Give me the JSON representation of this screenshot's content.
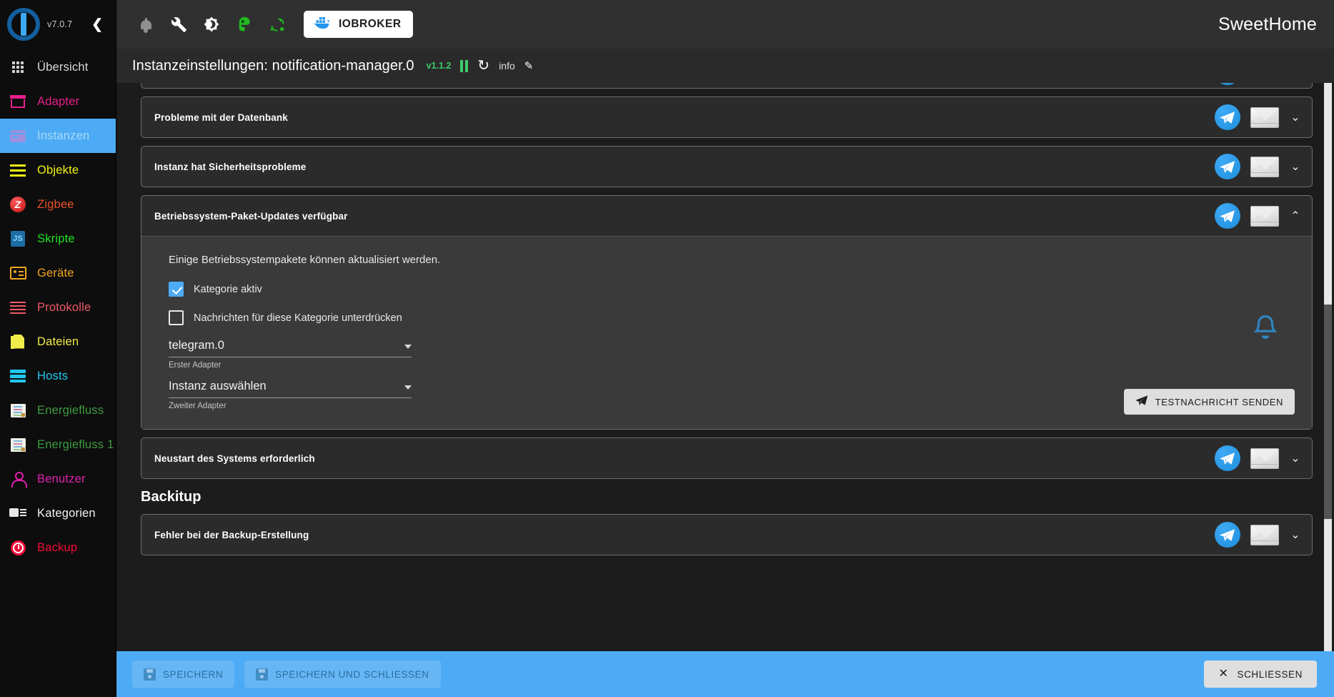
{
  "sidebar": {
    "version": "v7.0.7",
    "collapse_icon": "chevron-left-icon",
    "items": [
      {
        "label": "Übersicht",
        "icon": "grid-icon",
        "color": "#dcdcdc",
        "active": false
      },
      {
        "label": "Adapter",
        "icon": "shop-icon",
        "color": "#e91e8c",
        "active": false
      },
      {
        "label": "Instanzen",
        "icon": "instances-icon",
        "color": "#a9d9f7",
        "active": true
      },
      {
        "label": "Objekte",
        "icon": "list-icon",
        "color": "#f3f315",
        "active": false
      },
      {
        "label": "Zigbee",
        "icon": "zigbee-icon",
        "color": "#e8512a",
        "active": false
      },
      {
        "label": "Skripte",
        "icon": "javascript-icon",
        "color": "#21e421",
        "active": false
      },
      {
        "label": "Geräte",
        "icon": "devices-icon",
        "color": "#f0a520",
        "active": false
      },
      {
        "label": "Protokolle",
        "icon": "log-icon",
        "color": "#ef5a68",
        "active": false
      },
      {
        "label": "Dateien",
        "icon": "files-icon",
        "color": "#f0ec4a",
        "active": false
      },
      {
        "label": "Hosts",
        "icon": "hosts-icon",
        "color": "#22c7ee",
        "active": false
      },
      {
        "label": "Energiefluss",
        "icon": "flow-icon",
        "color": "#3f9b3f",
        "active": false
      },
      {
        "label": "Energiefluss 1",
        "icon": "flow-icon",
        "color": "#3f9b3f",
        "active": false
      },
      {
        "label": "Benutzer",
        "icon": "user-icon",
        "color": "#e020b0",
        "active": false
      },
      {
        "label": "Kategorien",
        "icon": "categories-icon",
        "color": "#f2f2f2",
        "active": false
      },
      {
        "label": "Backup",
        "icon": "backup-icon",
        "color": "#f20d3a",
        "active": false
      }
    ]
  },
  "topbar": {
    "icons": [
      "bell-icon",
      "wrench-icon",
      "brightness-icon",
      "bot-head-icon",
      "sync-icon"
    ],
    "host_button": {
      "label": "IOBROKER",
      "icon": "docker-icon"
    },
    "app_title": "SweetHome"
  },
  "subheader": {
    "title": "Instanzeinstellungen: notification-manager.0",
    "version": "v1.1.2",
    "pause_icon": "pause-icon",
    "refresh_icon": "refresh-icon",
    "info_label": "info",
    "edit_icon": "pencil-icon"
  },
  "content": {
    "cards": [
      {
        "title": "Probleme mit der Datenbank",
        "expanded": false,
        "chevron": "chevron-down-icon"
      },
      {
        "title": "Instanz hat Sicherheitsprobleme",
        "expanded": false,
        "chevron": "chevron-down-icon"
      },
      {
        "title": "Betriebssystem-Paket-Updates verfügbar",
        "expanded": true,
        "chevron": "chevron-up-icon"
      },
      {
        "title": "Neustart des Systems erforderlich",
        "expanded": false,
        "chevron": "chevron-down-icon"
      }
    ],
    "expanded_card": {
      "description": "Einige Betriebssystempakete können aktualisiert werden.",
      "checkbox_active": {
        "label": "Kategorie aktiv",
        "checked": true
      },
      "checkbox_suppress": {
        "label": "Nachrichten für diese Kategorie unterdrücken",
        "checked": false
      },
      "first_adapter": {
        "value": "telegram.0",
        "helper": "Erster Adapter"
      },
      "second_adapter": {
        "value": "Instanz auswählen",
        "helper": "Zweiter Adapter"
      },
      "test_button": {
        "label": "TESTNACHRICHT SENDEN",
        "icon": "send-icon"
      },
      "watermark_icon": "bell-icon"
    },
    "group_title": "Backitup",
    "backup_cards": [
      {
        "title": "Fehler bei der Backup-Erstellung",
        "expanded": false,
        "chevron": "chevron-down-icon"
      }
    ],
    "row_icons": {
      "telegram": "telegram-icon",
      "email": "email-icon"
    }
  },
  "footer": {
    "save_label": "SPEICHERN",
    "save_close_label": "SPEICHERN UND SCHLIESSEN",
    "close_label": "SCHLIESSEN",
    "save_icon": "save-icon",
    "close_icon": "close-icon"
  },
  "colors": {
    "accent": "#4dabf5",
    "sidebar_bg": "#0d0d0d",
    "card_bg": "#2b2b2b",
    "body_bg": "#3a3a3a",
    "telegram_blue": "#1d8fdc",
    "green": "#3fcb6b"
  }
}
